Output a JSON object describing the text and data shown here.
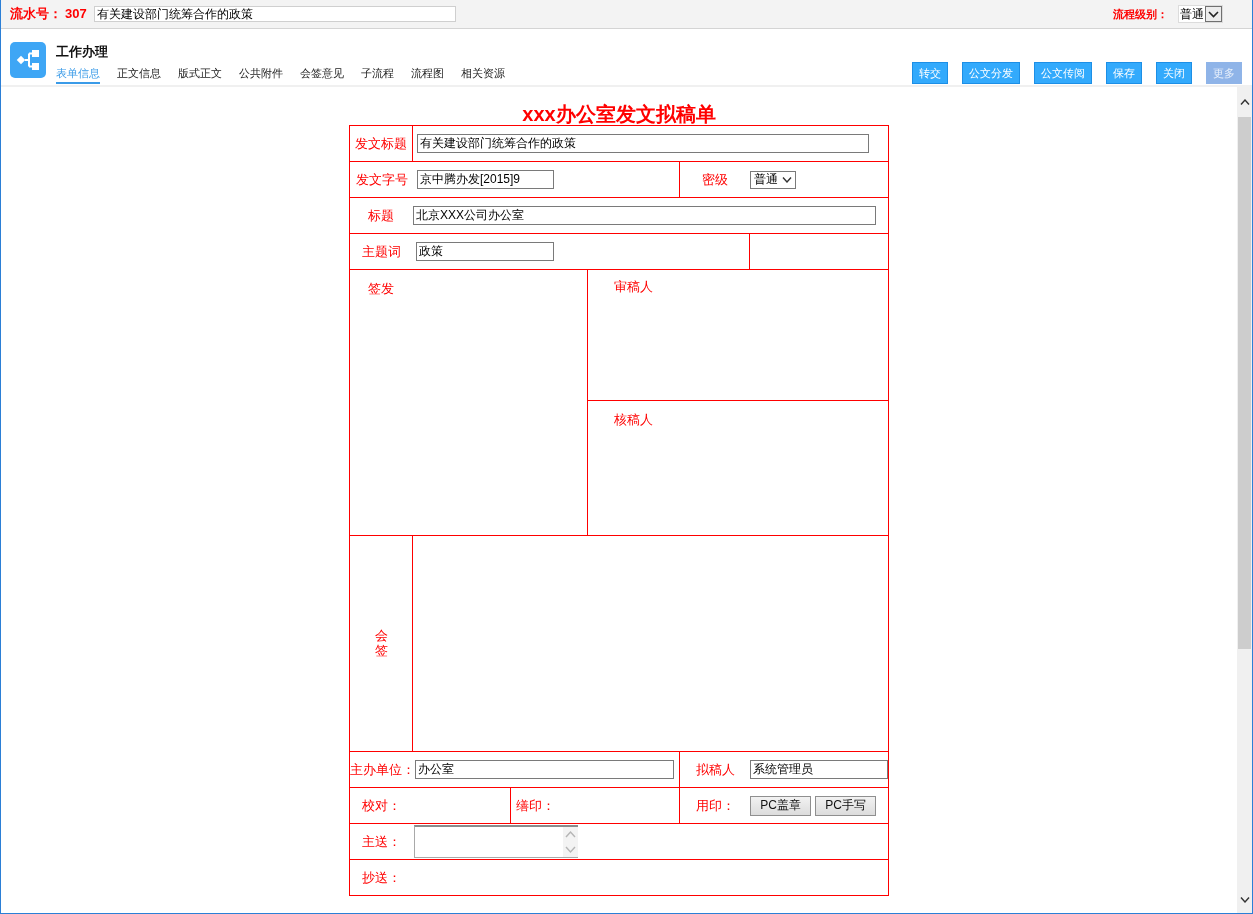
{
  "top_bar": {
    "serial_label": "流水号：",
    "serial_number": "307",
    "subject": "有关建设部门统筹合作的政策",
    "level_label": "流程级别：",
    "level_value": "普通"
  },
  "header": {
    "title": "工作办理",
    "tabs": [
      {
        "label": "表单信息",
        "selected": true
      },
      {
        "label": "正文信息",
        "selected": false
      },
      {
        "label": "版式正文",
        "selected": false
      },
      {
        "label": "公共附件",
        "selected": false
      },
      {
        "label": "会签意见",
        "selected": false
      },
      {
        "label": "子流程",
        "selected": false
      },
      {
        "label": "流程图",
        "selected": false
      },
      {
        "label": "相关资源",
        "selected": false
      }
    ],
    "buttons": [
      {
        "label": "转交",
        "disabled": false
      },
      {
        "label": "公文分发",
        "disabled": false
      },
      {
        "label": "公文传阅",
        "disabled": false
      },
      {
        "label": "保存",
        "disabled": false
      },
      {
        "label": "关闭",
        "disabled": false
      },
      {
        "label": "更多",
        "disabled": true
      }
    ]
  },
  "form": {
    "title": "xxx办公室发文拟稿单",
    "doc_title": {
      "label": "发文标题",
      "value": "有关建设部门统筹合作的政策"
    },
    "doc_number": {
      "label": "发文字号",
      "value": "京中腾办发[2015]9"
    },
    "secrecy": {
      "label": "密级",
      "value": "普通"
    },
    "heading": {
      "label": "标题",
      "value": "北京XXX公司办公室"
    },
    "keywords": {
      "label": "主题词",
      "value": "政策"
    },
    "sign_off": {
      "label": "签发"
    },
    "reviewer": {
      "label": "审稿人"
    },
    "checker": {
      "label": "核稿人"
    },
    "countersign": {
      "label": "会签"
    },
    "host_unit": {
      "label": "主办单位：",
      "value": "办公室"
    },
    "drafter": {
      "label": "拟稿人",
      "value": "系统管理员"
    },
    "proofread": {
      "label": "校对："
    },
    "typeset": {
      "label": "缮印："
    },
    "seal": {
      "label": "用印：",
      "buttons": [
        "PC盖章",
        "PC手写"
      ]
    },
    "main_recipient": {
      "label": "主送："
    },
    "cc": {
      "label": "抄送："
    }
  }
}
